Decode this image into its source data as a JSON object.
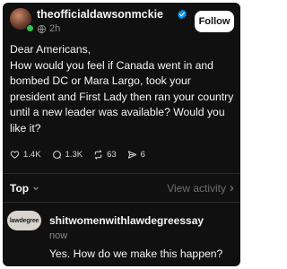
{
  "post": {
    "username": "theofficialdawsonmckie",
    "time": "2h",
    "follow_label": "Follow",
    "text": "Dear Americans,\nHow would you feel if Canada went in and bombed DC or Mara Largo, took your president and First Lady then ran your country until a new leader was available? Would you like it?",
    "icons": {
      "verified": "verified-badge-icon",
      "time": "globe-icon",
      "like": "heart-icon",
      "reply": "comment-icon",
      "repost": "repost-icon",
      "share": "send-icon"
    },
    "stats": {
      "likes": "1.4K",
      "replies": "1.3K",
      "reposts": "63",
      "shares": "6"
    }
  },
  "replies_header": {
    "sort_label": "Top",
    "view_activity_label": "View activity"
  },
  "reply": {
    "avatar_text": "lawdegree",
    "username": "shitwomenwithlawdegreessay",
    "time": "now",
    "text": "Yes. How do we make this happen?"
  },
  "colors": {
    "background": "#101010",
    "text": "#f3f5f7",
    "muted": "#8a8a8a",
    "verified": "#0095f6",
    "online": "#2fbf4a"
  }
}
